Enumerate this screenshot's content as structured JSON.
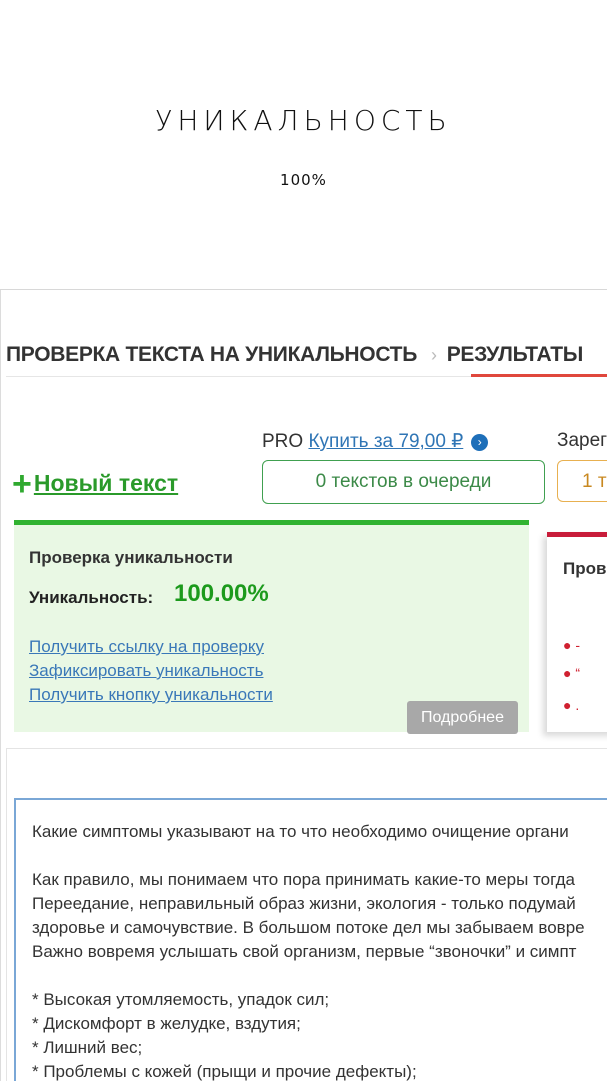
{
  "header": {
    "title": "УНИКАЛЬНОСТЬ",
    "subtitle": "100%"
  },
  "breadcrumb": {
    "step1": "ПРОВЕРКА ТЕКСТА НА УНИКАЛЬНОСТЬ",
    "separator": "›",
    "step2": "РЕЗУЛЬТАТЫ"
  },
  "toolbar": {
    "pro_label": "PRO",
    "buy_link": "Купить за 79,00 ₽",
    "registered_label": "Зарег",
    "new_text": "Новый текст",
    "queue_status": "0 текстов в очереди",
    "orange_box_text": "1 т"
  },
  "uniqueness_card": {
    "title": "Проверка уникальности",
    "uniqueness_label": "Уникальность:",
    "uniqueness_value": "100.00%",
    "links": [
      "Получить ссылку на проверку",
      "Зафиксировать уникальность",
      "Получить кнопку уникальности"
    ],
    "more_button": "Подробнее"
  },
  "side_card": {
    "title": "Пров",
    "bullets": [
      "-",
      "“",
      "."
    ]
  },
  "text_area": {
    "lines": [
      "Какие симптомы указывают на то что необходимо очищение органи",
      "",
      "Как правило, мы понимаем что пора принимать какие-то меры тогда",
      "Переедание, неправильный образ жизни, экология - только подумай",
      "здоровье и самочувствие. В большом потоке дел мы забываем вовре",
      "Важно вовремя услышать свой организм, первые “звоночки” и симпт",
      "",
      "* Высокая утомляемость, упадок сил;",
      "* Дискомфорт в желудке, вздутия;",
      "* Лишний вес;",
      "* Проблемы с кожей (прыщи и прочие дефекты);"
    ]
  },
  "colors": {
    "accent_green": "#31b331",
    "link_blue": "#3a78b8",
    "accent_red": "#c81c3a",
    "card_bg": "#e9f8e4"
  }
}
